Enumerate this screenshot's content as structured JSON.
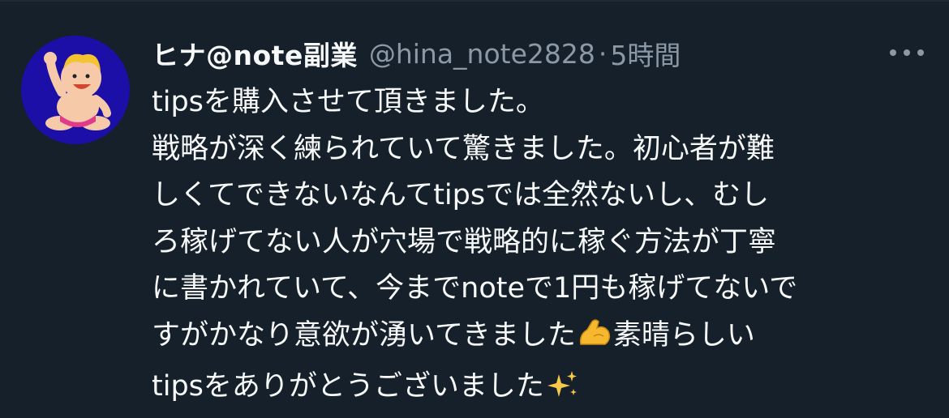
{
  "tweet": {
    "display_name": "ヒナ@note副業",
    "handle": "@hina_note2828",
    "separator": "·",
    "timestamp": "5時間",
    "avatar_icon": "cartoon-baby-avatar",
    "more_icon": "more-dots-icon",
    "lines": [
      "tipsを購入させて頂きました。",
      "戦略が深く練られていて驚きました。初心者が難",
      "しくてできないなんてtipsでは全然ないし、むし",
      "ろ稼げてない人が穴場で戦略的に稼ぐ方法が丁寧",
      "に書かれていて、今までnoteで1円も稼げてないで",
      "すがかなり意欲が湧いてきました",
      "素晴らしい",
      "tipsをありがとうございました"
    ],
    "emojis": {
      "flexed_biceps": "flexed-biceps-emoji",
      "sparkles": "sparkles-emoji"
    }
  },
  "colors": {
    "background": "#15202b",
    "primary_text": "#f7f9f9",
    "secondary_text": "#8b98a5",
    "avatar_bg": "#1b0fa8"
  }
}
